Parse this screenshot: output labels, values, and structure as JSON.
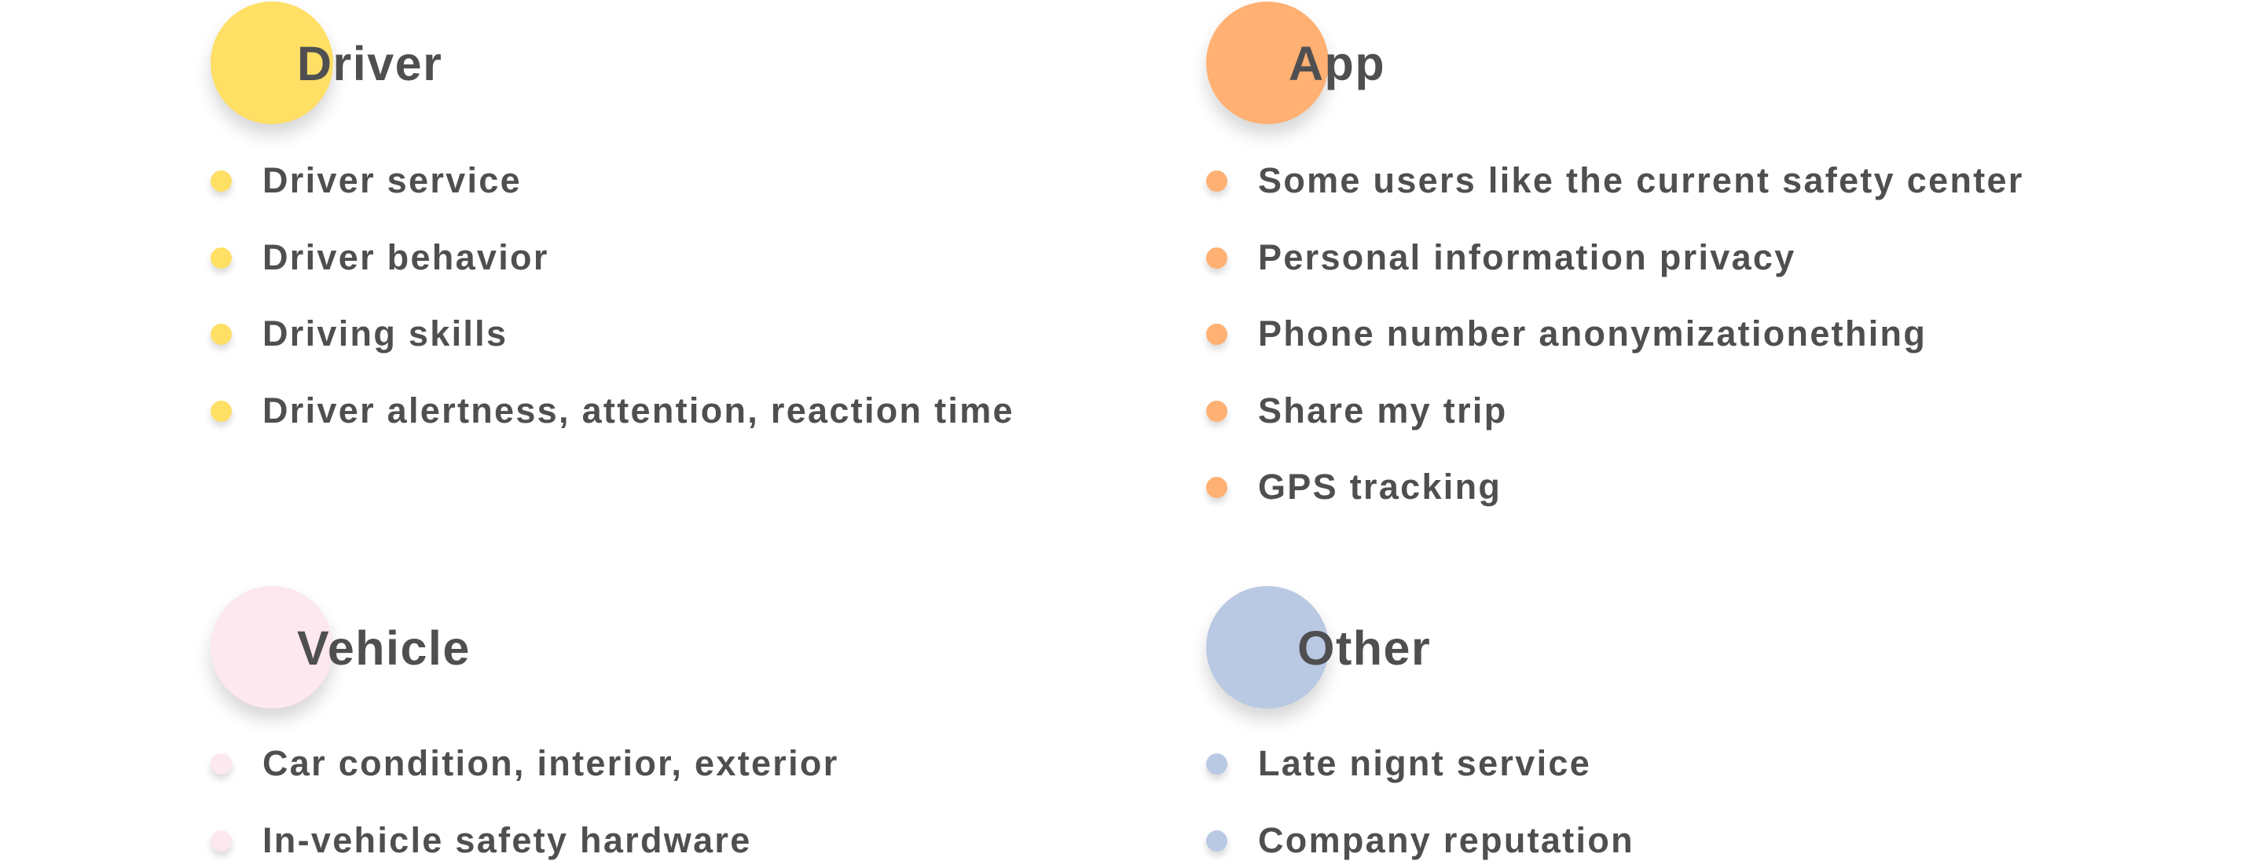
{
  "categories": {
    "driver": {
      "title": "Driver",
      "color": "#ffdf64",
      "items": [
        "Driver service",
        "Driver behavior",
        "Driving skills",
        "Driver alertness, attention, reaction time"
      ]
    },
    "app": {
      "title": "App",
      "color": "#ffb072",
      "items": [
        "Some users like the current safety center",
        "Personal information privacy",
        "Phone number anonymizationething",
        "Share my trip",
        "GPS tracking"
      ]
    },
    "vehicle": {
      "title": "Vehicle",
      "color": "#fce8ee",
      "items": [
        "Car condition, interior, exterior",
        "In-vehicle safety hardware"
      ]
    },
    "other": {
      "title": "Other",
      "color": "#b9c9e3",
      "items": [
        "Late nignt service",
        "Company reputation"
      ]
    }
  }
}
